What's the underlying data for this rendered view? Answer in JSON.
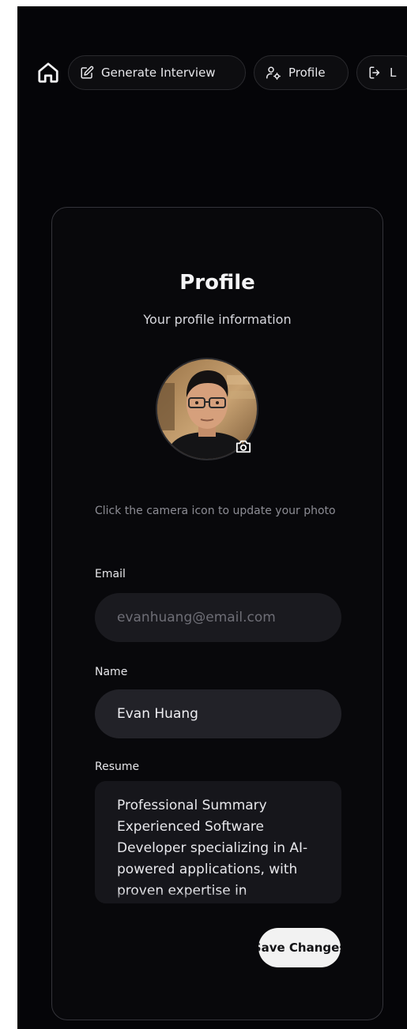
{
  "nav": {
    "generate_label": "Generate Interview",
    "profile_label": "Profile",
    "logout_label": "L"
  },
  "card": {
    "title": "Profile",
    "subtitle": "Your profile information",
    "photo_hint": "Click the camera icon to update your photo",
    "email_label": "Email",
    "email_value": "evanhuang@email.com",
    "name_label": "Name",
    "name_value": "Evan Huang",
    "resume_label": "Resume",
    "resume_value": "Professional Summary\nExperienced Software Developer specializing in AI-powered applications, with proven expertise in",
    "save_label": "Save Changes"
  },
  "colors": {
    "background": "#050508",
    "card_border": "#34343a",
    "input_bg": "#1a1a1f",
    "save_button_bg": "#f2f2f2"
  },
  "icons": {
    "home": "home-icon",
    "generate": "edit-icon",
    "profile": "user-icon",
    "logout": "logout-icon",
    "camera": "camera-icon"
  }
}
